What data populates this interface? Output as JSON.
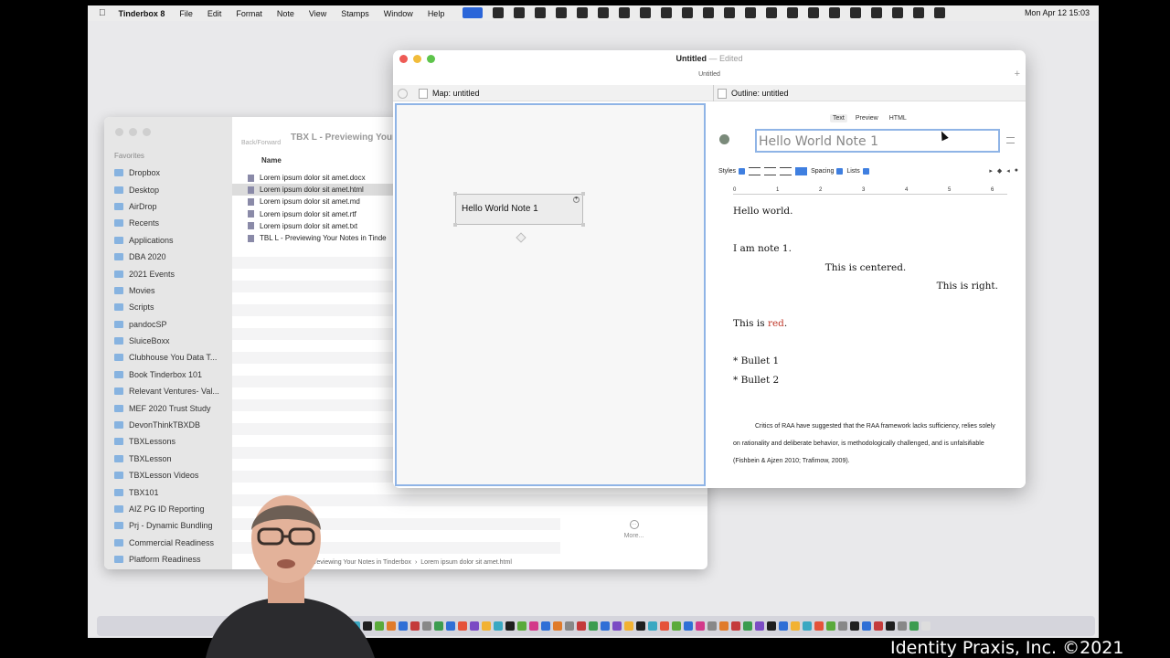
{
  "menubar": {
    "app": "Tinderbox 8",
    "items": [
      "File",
      "Edit",
      "Format",
      "Note",
      "View",
      "Stamps",
      "Window",
      "Help"
    ],
    "clock": "Mon Apr 12  15:03"
  },
  "finder": {
    "title": "TBX L - Previewing Your",
    "nav_label": "Back/Forward",
    "favorites_label": "Favorites",
    "sidebar": [
      "Dropbox",
      "Desktop",
      "AirDrop",
      "Recents",
      "Applications",
      "DBA 2020",
      "2021 Events",
      "Movies",
      "Scripts",
      "pandocSP",
      "SluiceBoxx",
      "Clubhouse You  Data T...",
      "Book Tinderbox 101",
      "Relevant Ventures- Val...",
      "MEF 2020 Trust Study",
      "DevonThinkTBXDB",
      "TBXLessons",
      "TBXLesson",
      "TBXLesson Videos",
      "TBX101",
      "AIZ PG ID Reporting",
      "Prj - Dynamic Bundling",
      "Commercial Readiness",
      "Platform Readiness"
    ],
    "column_name": "Name",
    "files": [
      "Lorem ipsum dolor sit amet.docx",
      "Lorem ipsum dolor sit amet.html",
      "Lorem ipsum dolor sit amet.md",
      "Lorem ipsum dolor sit amet.rtf",
      "Lorem ipsum dolor sit amet.txt",
      "TBL L - Previewing Your Notes in Tinde"
    ],
    "selected_file_index": 1,
    "more_label": "More...",
    "path": [
      "TBX L - Previewing Your Notes in Tinderbox",
      "Lorem ipsum dolor sit amet.html"
    ]
  },
  "tbx": {
    "title": "Untitled",
    "edited": "— Edited",
    "subtitle": "Untitled",
    "tab_map": "Map: untitled",
    "tab_outline": "Outline: untitled",
    "map_note": "Hello World Note 1",
    "modes": [
      "Text",
      "Preview",
      "HTML"
    ],
    "note_title": "Hello World Note 1",
    "styles_label": "Styles",
    "spacing_label": "Spacing",
    "lists_label": "Lists",
    "ruler": [
      "0",
      "1",
      "2",
      "3",
      "4",
      "5",
      "6"
    ],
    "doc": {
      "line1": "Hello world.",
      "line2": "I am note 1.",
      "centered": "This is centered.",
      "right": "This is right.",
      "red_prefix": "This is ",
      "red_word": "red",
      "red_suffix": ".",
      "bullet1": "* Bullet 1",
      "bullet2": "* Bullet 2",
      "citation": "Critics of RAA have suggested that the RAA framework lacks sufficiency, relies solely on rationality and deliberate behavior, is methodologically challenged, and is unfalsifiable (Fishbein & Ajzen 2010; Trafimow, 2009)."
    }
  },
  "watermark": "Identity Praxis, Inc. ©2021"
}
